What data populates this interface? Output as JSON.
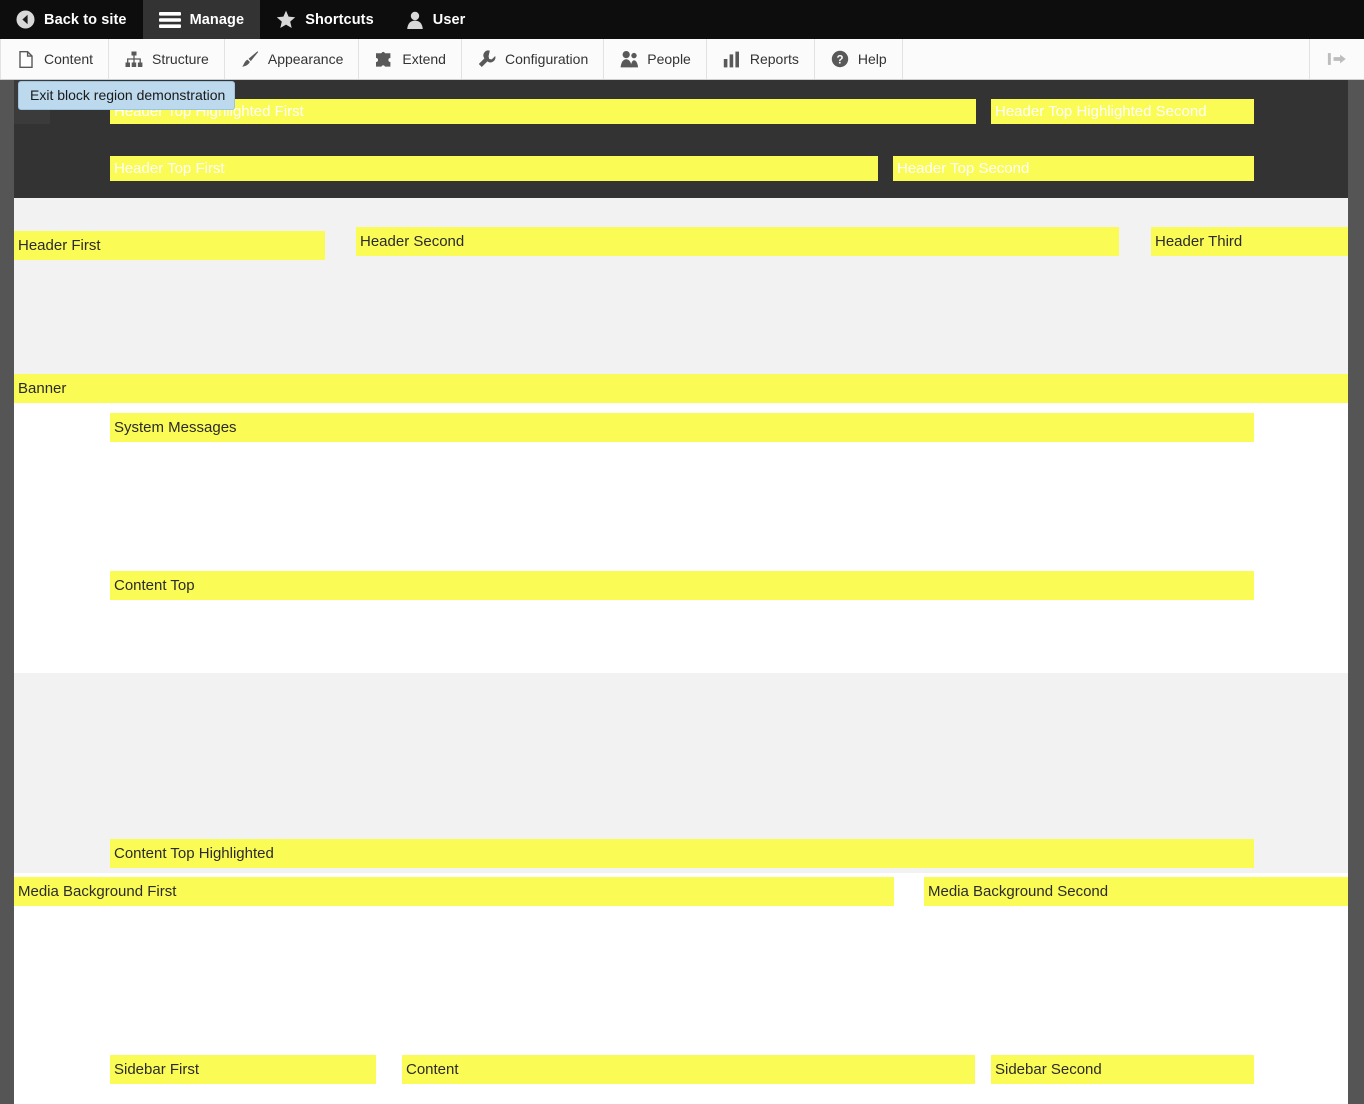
{
  "toolbar": {
    "tabs": [
      {
        "label": "Back to site",
        "icon": "back-arrow-icon",
        "active": false
      },
      {
        "label": "Manage",
        "icon": "hamburger-icon",
        "active": true
      },
      {
        "label": "Shortcuts",
        "icon": "star-icon",
        "active": false
      },
      {
        "label": "User",
        "icon": "user-icon",
        "active": false
      }
    ]
  },
  "admin_menu": {
    "items": [
      {
        "label": "Content",
        "icon": "page-icon"
      },
      {
        "label": "Structure",
        "icon": "structure-icon"
      },
      {
        "label": "Appearance",
        "icon": "paintbrush-icon"
      },
      {
        "label": "Extend",
        "icon": "puzzle-icon"
      },
      {
        "label": "Configuration",
        "icon": "wrench-icon"
      },
      {
        "label": "People",
        "icon": "people-icon"
      },
      {
        "label": "Reports",
        "icon": "bar-chart-icon"
      },
      {
        "label": "Help",
        "icon": "question-mark-icon"
      }
    ],
    "orientation_toggle_icon": "vertical-orientation-icon"
  },
  "overlay": {
    "exit_button_label": "Exit block region demonstration"
  },
  "colors": {
    "region_highlight": "#fbfb55",
    "dark_band": "#333333",
    "grey_band": "#f2f2f2",
    "white_band": "#ffffff",
    "page_gutter": "#555555",
    "toolbar_bar": "#0d0d0d",
    "toolbar_tab_active": "#333333",
    "exit_button": "#bcd9ed"
  },
  "regions": [
    {
      "name": "header-top-highlighted-first",
      "label": "Header Top Highlighted First",
      "on_dark": true
    },
    {
      "name": "header-top-highlighted-second",
      "label": "Header Top Highlighted Second",
      "on_dark": true
    },
    {
      "name": "header-top-first",
      "label": "Header Top First",
      "on_dark": true
    },
    {
      "name": "header-top-second",
      "label": "Header Top Second",
      "on_dark": true
    },
    {
      "name": "header-first",
      "label": "Header First",
      "on_dark": false
    },
    {
      "name": "header-second",
      "label": "Header Second",
      "on_dark": false
    },
    {
      "name": "header-third",
      "label": "Header Third",
      "on_dark": false
    },
    {
      "name": "banner",
      "label": "Banner",
      "on_dark": false
    },
    {
      "name": "system-messages",
      "label": "System Messages",
      "on_dark": false
    },
    {
      "name": "content-top",
      "label": "Content Top",
      "on_dark": false
    },
    {
      "name": "content-top-highlighted",
      "label": "Content Top Highlighted",
      "on_dark": false
    },
    {
      "name": "media-background-first",
      "label": "Media Background First",
      "on_dark": false
    },
    {
      "name": "media-background-second",
      "label": "Media Background Second",
      "on_dark": false
    },
    {
      "name": "sidebar-first",
      "label": "Sidebar First",
      "on_dark": false
    },
    {
      "name": "content",
      "label": "Content",
      "on_dark": false
    },
    {
      "name": "sidebar-second",
      "label": "Sidebar Second",
      "on_dark": false
    }
  ]
}
